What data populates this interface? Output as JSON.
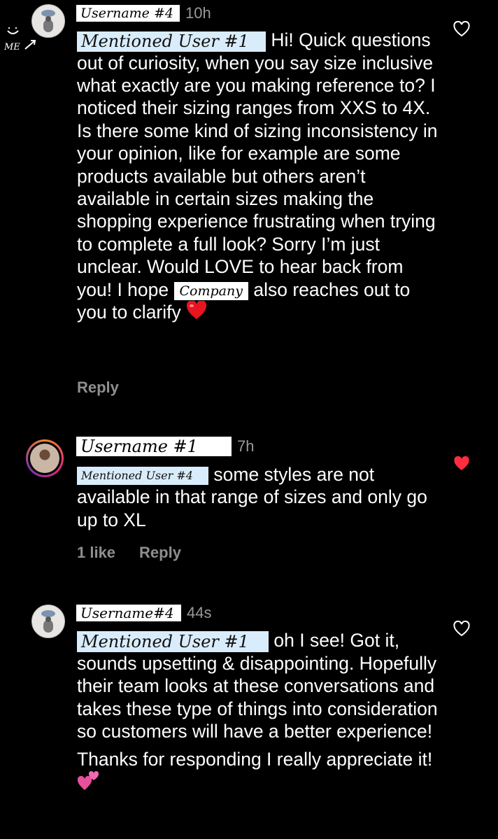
{
  "me_note": "ME",
  "comments": [
    {
      "username": "Username #4",
      "time": "10h",
      "mention": "Mentioned User #1",
      "text_a": "Hi! Quick questions out of curiosity, when you say size inclusive what exactly are you making reference to? I noticed their sizing ranges from XXS to 4X. Is there some kind of sizing inconsistency in your opinion, like for example are some products  available but others aren’t available in certain sizes making the shopping experience frustrating when trying to complete a full look? Sorry I’m just unclear. Would LOVE to hear back from you! I hope",
      "company": "Company",
      "text_b": "also reaches out to you to clarify",
      "reply_label": "Reply",
      "liked": false
    },
    {
      "username": "Username #1",
      "time": "7h",
      "mention": "Mentioned User #4",
      "text_a": "some styles are not available in that range of sizes and only go up to XL",
      "likes_label": "1 like",
      "reply_label": "Reply",
      "liked": true
    },
    {
      "username": "Username#4",
      "time": "44s",
      "mention": "Mentioned User #1",
      "text_a": "oh I see! Got it, sounds upsetting & disappointing. Hopefully their team looks at these conversations and takes these type of things into consideration so customers will have a better experience!",
      "text_c": "Thanks for responding I really appreciate it!",
      "liked": false
    }
  ],
  "colors": {
    "like_red": "#ff2d3f",
    "mention_bg": "#d9ecfb",
    "meta_gray": "#8e8e8e"
  },
  "icons": {
    "like": "heart-outline-icon",
    "liked": "heart-filled-icon",
    "emoji_1": "red-heart-emoji",
    "emoji_2": "two-hearts-emoji"
  }
}
